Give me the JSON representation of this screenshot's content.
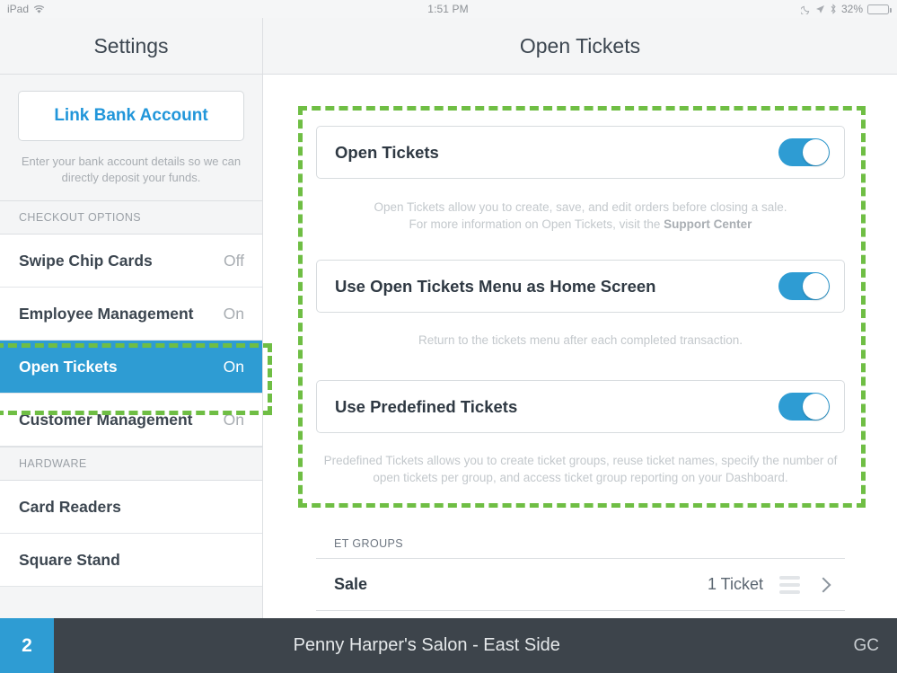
{
  "statusbar": {
    "device": "iPad",
    "wifi_icon": "wifi-icon",
    "time": "1:51 PM",
    "dnd_icon": "moon-icon",
    "location_icon": "location-arrow-icon",
    "bluetooth_icon": "bluetooth-icon",
    "battery_percent": "32%",
    "battery_icon": "battery-icon"
  },
  "nav": {
    "left_title": "Settings",
    "right_title": "Open Tickets"
  },
  "sidebar": {
    "bank_button": "Link Bank Account",
    "bank_note": "Enter your bank account details so we can directly deposit your funds.",
    "sections": [
      {
        "header": "CHECKOUT OPTIONS",
        "items": [
          {
            "label": "Swipe Chip Cards",
            "value": "Off",
            "selected": false
          },
          {
            "label": "Employee Management",
            "value": "On",
            "selected": false
          },
          {
            "label": "Open Tickets",
            "value": "On",
            "selected": true
          },
          {
            "label": "Customer Management",
            "value": "On",
            "selected": false
          }
        ]
      },
      {
        "header": "HARDWARE",
        "items": [
          {
            "label": "Card Readers",
            "value": "",
            "selected": false
          },
          {
            "label": "Square Stand",
            "value": "",
            "selected": false
          }
        ]
      }
    ]
  },
  "main": {
    "settings": [
      {
        "label": "Open Tickets",
        "toggle_state": "on",
        "help_line1": "Open Tickets allow you to create, save, and edit orders before closing a sale.",
        "help_line2_prefix": "For more information on Open Tickets, visit the ",
        "help_line2_link": "Support Center"
      },
      {
        "label": "Use Open Tickets Menu as Home Screen",
        "toggle_state": "on",
        "help_line1": "Return to the tickets menu after each completed transaction.",
        "help_line2_prefix": "",
        "help_line2_link": ""
      },
      {
        "label": "Use Predefined Tickets",
        "toggle_state": "on",
        "help_line1": "Predefined Tickets allows you to create ticket groups, reuse ticket names, specify",
        "help_line2_prefix": "the number of open tickets per group, and access ticket group reporting on your Dashboard.",
        "help_line2_link": ""
      }
    ],
    "groups_header": "ET GROUPS",
    "groups": [
      {
        "name": "Sale",
        "count": "1 Ticket",
        "reorder_icon": "reorder-handle-icon",
        "chevron_icon": "chevron-right-icon"
      }
    ]
  },
  "bottombar": {
    "open_ticket_count": "2",
    "store_name": "Penny Harper's Salon - East Side",
    "user_initials": "GC"
  },
  "colors": {
    "accent_blue": "#2e9cd3",
    "link_blue": "#2196da",
    "annotation_green": "#6fbe44",
    "bottom_bar": "#3d444b",
    "panel_bg": "#f4f5f6",
    "text_dark": "#3c4650",
    "text_muted": "#a8adb2"
  }
}
